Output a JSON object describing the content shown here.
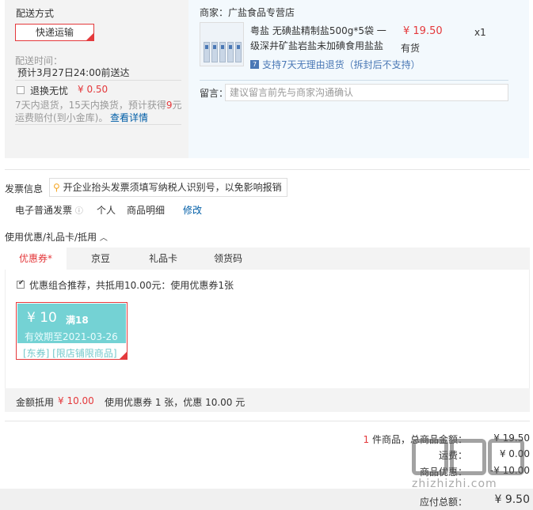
{
  "shipping": {
    "title": "配送方式",
    "express_label": "快递运输",
    "time_title": "配送时间：",
    "time_value": "预计3月27日24:00前送达",
    "return_label": "退换无忧",
    "return_price": "¥ 0.50",
    "return_desc_1": "7天内退货，15天内换货，预计获得",
    "return_desc_num": "9",
    "return_desc_2": "元",
    "return_desc_3": "运费赔付(到小金库)。",
    "return_link": "查看详情"
  },
  "store": {
    "label": "商家：广盐食品专营店",
    "product_title_line1": "粤盐 无碘盐精制盐500g*5袋 一",
    "product_title_line2": "级深井矿盐岩盐未加碘食用盐盐",
    "price": "¥ 19.50",
    "qty": "x1",
    "stock": "有货",
    "return_tag_icon": "7",
    "return_tag": "支持7天无理由退货（拆封后不支持）",
    "message_label": "留言：",
    "message_placeholder": "建议留言前先与商家沟通确认"
  },
  "invoice": {
    "title": "发票信息",
    "tip": "开企业抬头发票须填写纳税人识别号，以免影响报销",
    "type": "电子普通发票",
    "target": "个人",
    "detail": "商品明细",
    "edit": "修改"
  },
  "discount": {
    "title": "使用优惠/礼品卡/抵用",
    "tabs": [
      {
        "label": "优惠券",
        "badge": "*",
        "active": true
      },
      {
        "label": "京豆",
        "badge": "",
        "active": false
      },
      {
        "label": "礼品卡",
        "badge": "",
        "active": false
      },
      {
        "label": "领货码",
        "badge": "",
        "active": false
      }
    ],
    "combo_text": "优惠组合推荐，共抵用10.00元：使用优惠券1张",
    "coupon": {
      "amount": "¥ 10",
      "condition": "满18",
      "validity": "有效期至2021-03-26",
      "scope": "[东券] [限店铺限商品]"
    },
    "footer_label": "金额抵用",
    "footer_amount": "¥ 10.00",
    "footer_desc": "使用优惠券 1 张，优惠 10.00 元"
  },
  "totals": {
    "count": "1",
    "count_suffix": "件商品，总商品金额：",
    "goods_amount": "¥ 19.50",
    "freight_label": "运费：",
    "freight_amount": "¥ 0.00",
    "discount_label": "商品优惠：",
    "discount_amount": "-¥ 10.00",
    "payable_label": "应付总额：",
    "payable_amount": "¥ 9.50"
  },
  "watermark": {
    "url": "zhizhizhi.com"
  }
}
